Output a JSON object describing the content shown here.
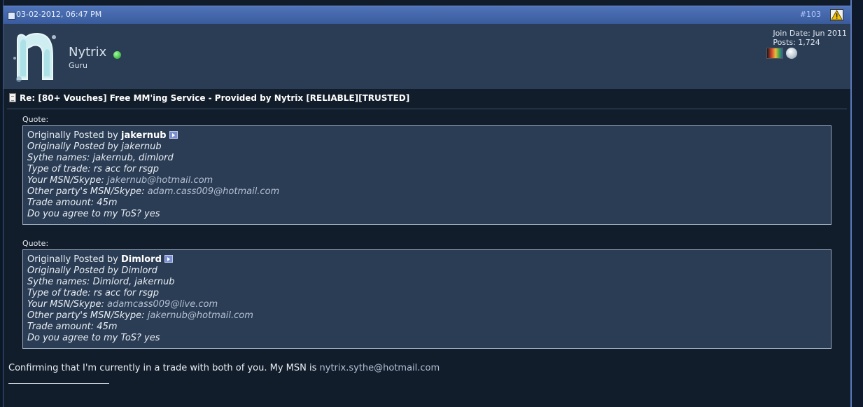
{
  "post_header": {
    "date": "03-02-2012, 06:47 PM",
    "post_number": "#103"
  },
  "user": {
    "name": "Nytrix",
    "title": "Guru",
    "join_date": "Join Date: Jun 2011",
    "posts": "Posts: 1,724",
    "online_status_color": "#2aa82a"
  },
  "post": {
    "title": "Re: [80+ Vouches] Free MM'ing Service - Provided by Nytrix [RELIABLE][TRUSTED]",
    "quotes": [
      {
        "label": "Quote:",
        "originally_posted_by": "Originally Posted by",
        "poster": "jakernub",
        "lines": [
          "Originally Posted by jakernub",
          "Sythe names: jakernub, dimlord",
          "Type of trade: rs acc for rsgp"
        ],
        "msn_label": "Your MSN/Skype:",
        "msn_value": "jakernub@hotmail.com",
        "other_label": "Other party's MSN/Skype:",
        "other_value": "adam.cass009@hotmail.com",
        "amount": "Trade amount: 45m",
        "tos": "Do you agree to my ToS? yes"
      },
      {
        "label": "Quote:",
        "originally_posted_by": "Originally Posted by",
        "poster": "Dimlord",
        "lines": [
          "Originally Posted by Dimlord",
          "Sythe names: Dimlord, jakernub",
          "Type of trade: rs acc for rsgp"
        ],
        "msn_label": "Your MSN/Skype:",
        "msn_value": "adamcass009@live.com",
        "other_label": "Other party's MSN/Skype:",
        "other_value": "jakernub@hotmail.com",
        "amount": "Trade amount: 45m",
        "tos": "Do you agree to my ToS? yes"
      }
    ],
    "message_text": "Confirming that I'm currently in a trade with both of you. My MSN is ",
    "message_email": "nytrix.sythe@hotmail.com"
  },
  "icons": {
    "post_status": "post-status-icon",
    "report": "warning-triangle-icon",
    "title_doc": "document-icon",
    "goto_post": "view-post-arrow-icon"
  },
  "colors": {
    "header_bar": "#4466aa",
    "user_panel": "#2b3d54",
    "post_number": "#b8c8ff",
    "quote_border": "#9aa8bc"
  }
}
